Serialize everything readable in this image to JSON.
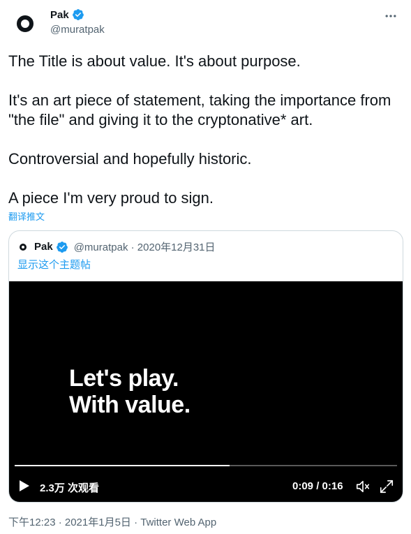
{
  "author": {
    "display_name": "Pak",
    "handle": "@muratpak",
    "verified_icon": "verified-badge-icon",
    "avatar_icon": "ring-logo-icon"
  },
  "more_icon": "more-horizontal-icon",
  "tweet": {
    "paragraphs": [
      "The Title is about value. It's about purpose.",
      "It's an art piece of statement, taking the importance from \"the file\" and giving it to the cryptonative* art.",
      "Controversial and hopefully historic.",
      "A piece I'm very proud to sign."
    ],
    "translate_label": "翻译推文"
  },
  "quote": {
    "display_name": "Pak",
    "meta": "@muratpak · 2020年12月31日",
    "show_thread": "显示这个主题帖",
    "video": {
      "overlay_line1": "Let's play.",
      "overlay_line2": "With value.",
      "views": "2.3万 次观看",
      "time": "0:09 / 0:16",
      "progress_fraction": 0.5625,
      "play_icon": "play-icon",
      "volume_icon": "volume-muted-icon",
      "fullscreen_icon": "fullscreen-icon"
    }
  },
  "footer": {
    "meta": "下午12:23 · 2021年1月5日 · Twitter Web App"
  },
  "colors": {
    "link": "#1d9bf0",
    "secondary_text": "#536471",
    "border": "#cfd9de",
    "verified": "#1d9bf0"
  }
}
